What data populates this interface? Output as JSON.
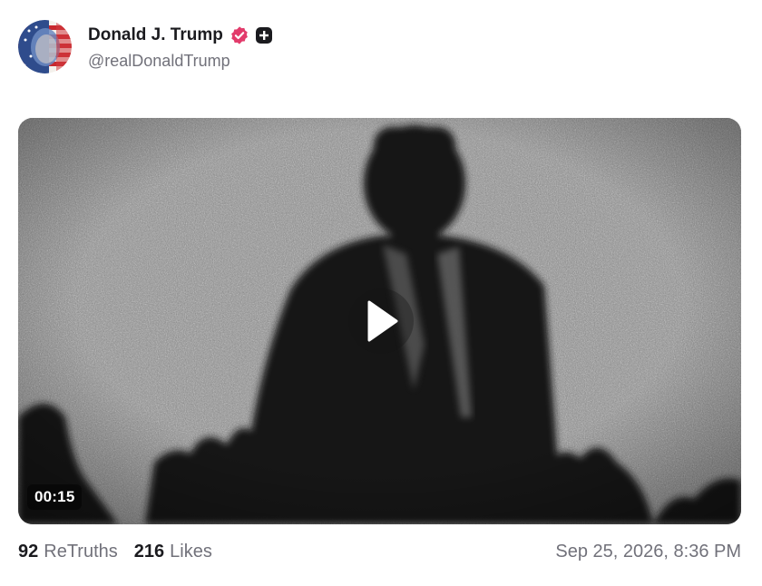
{
  "post": {
    "author": {
      "display_name": "Donald J. Trump",
      "handle": "@realDonaldTrump",
      "verified_icon": "verified-badge-icon",
      "verified_color": "#e23b6b",
      "plus_icon": "plus-badge-icon"
    },
    "media": {
      "type": "video",
      "duration": "00:15",
      "play_icon": "play-icon"
    },
    "stats": {
      "retruths_count": "92",
      "retruths_label": "ReTruths",
      "likes_count": "216",
      "likes_label": "Likes"
    },
    "timestamp": "Sep 25, 2026, 8:36 PM"
  }
}
